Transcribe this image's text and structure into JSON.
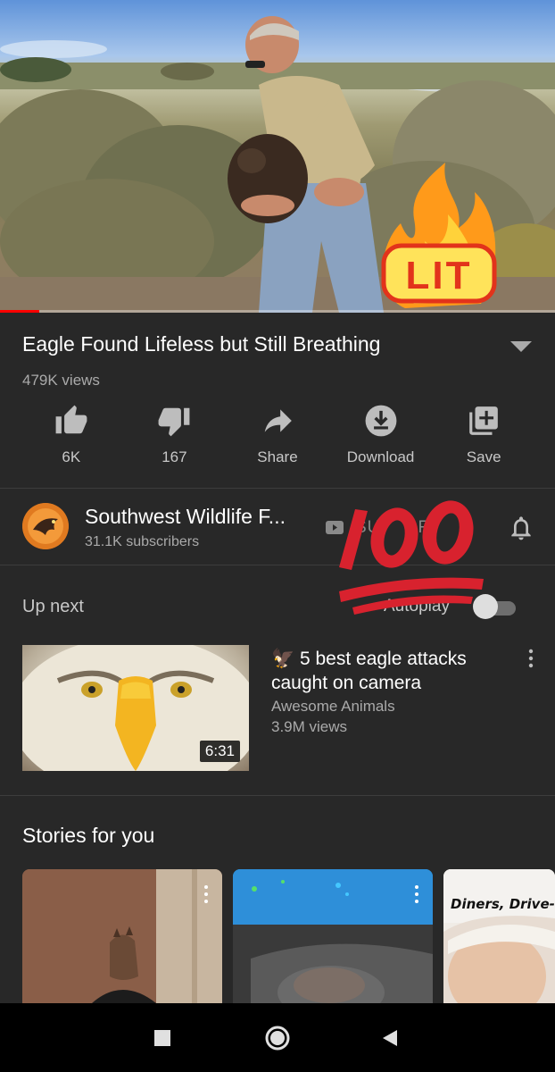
{
  "video": {
    "progress": 0.07,
    "sticker_text": "LIT",
    "title": "Eagle Found Lifeless but Still Breathing",
    "views": "479K views"
  },
  "actions": [
    {
      "label": "6K",
      "icon": "thumbs-up-icon"
    },
    {
      "label": "167",
      "icon": "thumbs-down-icon"
    },
    {
      "label": "Share",
      "icon": "share-icon"
    },
    {
      "label": "Download",
      "icon": "download-icon"
    },
    {
      "label": "Save",
      "icon": "add-to-playlist-icon"
    }
  ],
  "channel": {
    "name": "Southwest Wildlife F...",
    "subscribers": "31.1K subscribers",
    "subscribe_label": "SUBSCRIBED"
  },
  "up_next": {
    "label": "Up next",
    "autoplay_label": "Autoplay",
    "autoplay_on": false
  },
  "next_video": {
    "title": "🦅 5 best eagle attacks caught on camera",
    "channel": "Awesome Animals",
    "views": "3.9M views",
    "duration": "6:31"
  },
  "stories": {
    "title": "Stories for you",
    "items": [
      {
        "thumb": "horse-mask-person"
      },
      {
        "thumb": "dog-in-car"
      },
      {
        "text": "Diners, Drive-In"
      }
    ]
  },
  "colors": {
    "background": "#282828",
    "accent_red": "#ff0000",
    "secondary_text": "#aaaaaa"
  }
}
